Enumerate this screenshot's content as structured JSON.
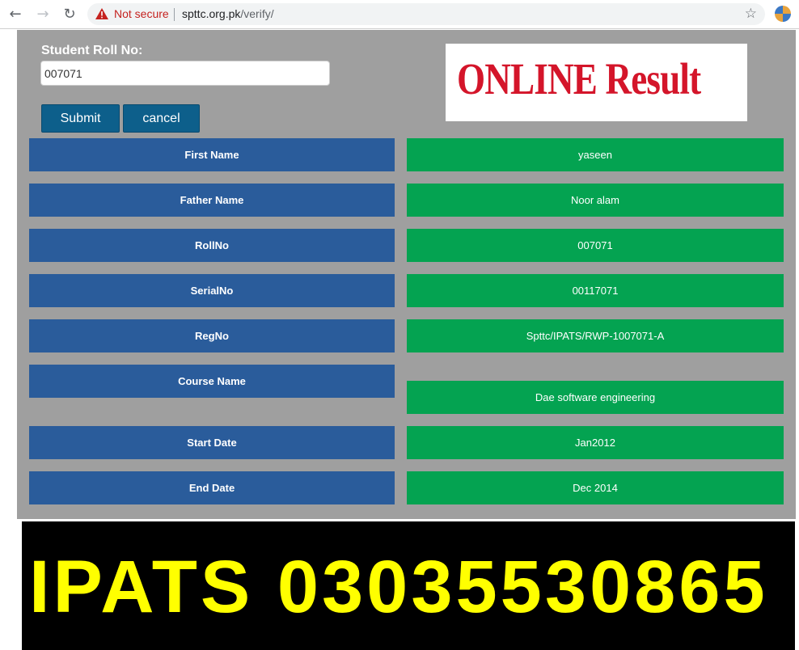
{
  "browser": {
    "security_label": "Not secure",
    "url_domain": "spttc.org.pk",
    "url_path": "/verify/"
  },
  "form": {
    "roll_label": "Student Roll No:",
    "roll_value": "007071",
    "submit_label": "Submit",
    "cancel_label": "cancel"
  },
  "banner": {
    "text": "ONLINE Result"
  },
  "result": {
    "rows": [
      {
        "label": "First Name",
        "value": "yaseen"
      },
      {
        "label": "Father Name",
        "value": "Noor alam"
      },
      {
        "label": "RollNo",
        "value": "007071"
      },
      {
        "label": "SerialNo",
        "value": "00117071"
      },
      {
        "label": "RegNo",
        "value": "Spttc/IPATS/RWP-1007071-A"
      },
      {
        "label": "Course Name",
        "value": "Dae software engineering"
      },
      {
        "label": "Start Date",
        "value": "Jan2012"
      },
      {
        "label": "End Date",
        "value": "Dec 2014"
      }
    ]
  },
  "ad": {
    "text": "IPATS 03035530865"
  },
  "colors": {
    "label_bg": "#2a5c9b",
    "value_bg": "#04a351",
    "panel_bg": "#9f9f9f",
    "button_bg": "#0d5f8b",
    "banner_red": "#d4152a",
    "ad_yellow": "#ffff00"
  }
}
